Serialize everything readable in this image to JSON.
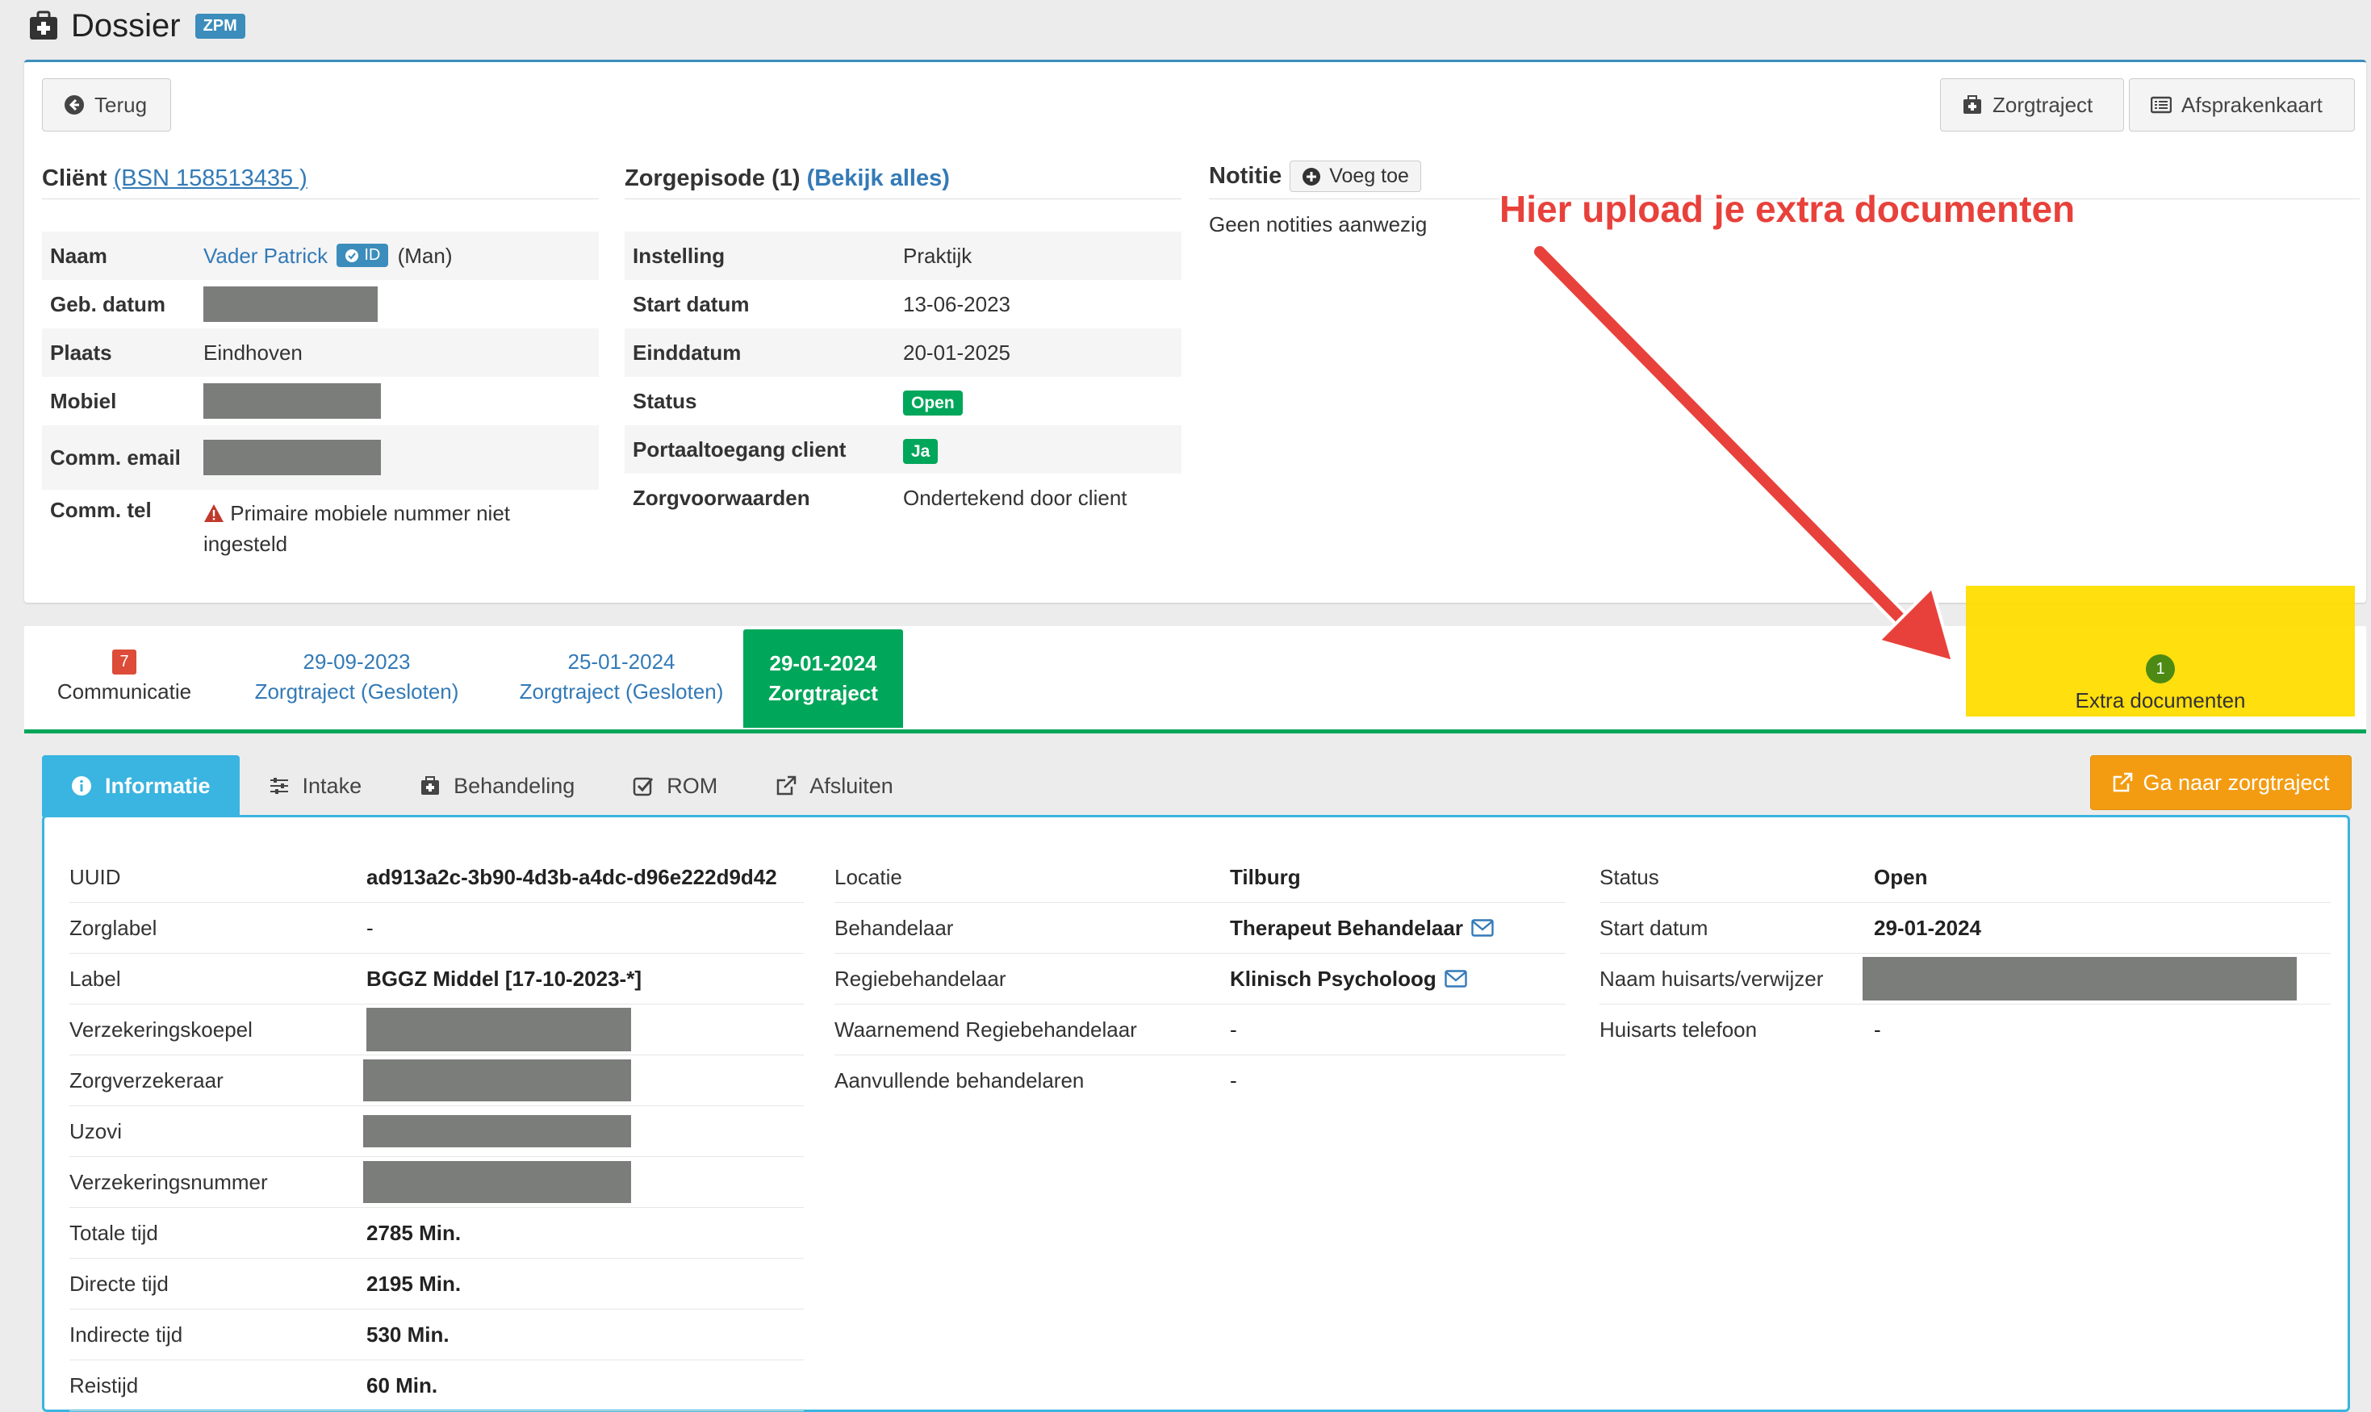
{
  "header": {
    "title": "Dossier",
    "badge": "ZPM",
    "icon": "medkit-icon"
  },
  "toolbar": {
    "back_label": "Terug",
    "zorgtraject_label": "Zorgtraject",
    "afsprakenkaart_label": "Afsprakenkaart"
  },
  "client": {
    "section_label": "Cliënt",
    "bsn_link": "(BSN 158513435 )",
    "rows": {
      "naam_key": "Naam",
      "naam_value": "Vader Patrick",
      "id_badge": "ID",
      "gender": "(Man)",
      "geb_key": "Geb. datum",
      "plaats_key": "Plaats",
      "plaats_value": "Eindhoven",
      "mobiel_key": "Mobiel",
      "email_key": "Comm. email",
      "tel_key": "Comm. tel",
      "tel_value": "Primaire mobiele nummer niet ingesteld"
    }
  },
  "episode": {
    "section_label": "Zorgepisode (1)",
    "view_all": "(Bekijk alles)",
    "rows": [
      {
        "key": "Instelling",
        "value": "Praktijk"
      },
      {
        "key": "Start datum",
        "value": "13-06-2023"
      },
      {
        "key": "Einddatum",
        "value": "20-01-2025"
      },
      {
        "key": "Status",
        "value": "Open"
      },
      {
        "key": "Portaaltoegang client",
        "value": "Ja"
      },
      {
        "key": "Zorgvoorwaarden",
        "value": "Ondertekend door client"
      }
    ]
  },
  "notitie": {
    "section_label": "Notitie",
    "add_label": "Voeg toe",
    "empty": "Geen notities aanwezig"
  },
  "annotation": {
    "text": "Hier upload je extra documenten",
    "color": "#e8413b",
    "highlight": "#ffdd00"
  },
  "tabs": {
    "communicatie": {
      "count": "7",
      "label": "Communicatie"
    },
    "z1": {
      "date": "29-09-2023",
      "label": "Zorgtraject (Gesloten)"
    },
    "z2": {
      "date": "25-01-2024",
      "label": "Zorgtraject (Gesloten)"
    },
    "z3": {
      "date": "29-01-2024",
      "label": "Zorgtraject"
    },
    "extra": {
      "count": "1",
      "label": "Extra documenten"
    }
  },
  "inner_tabs": [
    "Informatie",
    "Intake",
    "Behandeling",
    "ROM",
    "Afsluiten"
  ],
  "goto_button": "Ga naar zorgtraject",
  "info": {
    "col1": [
      {
        "key": "UUID",
        "value": "ad913a2c-3b90-4d3b-a4dc-d96e222d9d42"
      },
      {
        "key": "Zorglabel",
        "value": "-"
      },
      {
        "key": "Label",
        "value": "BGGZ Middel [17-10-2023-*]"
      },
      {
        "key": "Verzekeringskoepel",
        "value": ""
      },
      {
        "key": "Zorgverzekeraar",
        "value": ""
      },
      {
        "key": "Uzovi",
        "value": ""
      },
      {
        "key": "Verzekeringsnummer",
        "value": ""
      },
      {
        "key": "Totale tijd",
        "value": "2785 Min."
      },
      {
        "key": "Directe tijd",
        "value": "2195 Min."
      },
      {
        "key": "Indirecte tijd",
        "value": "530 Min."
      },
      {
        "key": "Reistijd",
        "value": "60 Min."
      }
    ],
    "col2": [
      {
        "key": "Locatie",
        "value": "Tilburg"
      },
      {
        "key": "Behandelaar",
        "value": "Therapeut Behandelaar"
      },
      {
        "key": "Regiebehandelaar",
        "value": "Klinisch Psycholoog"
      },
      {
        "key": "Waarnemend Regiebehandelaar",
        "value": "-"
      },
      {
        "key": "Aanvullende behandelaren",
        "value": "-"
      }
    ],
    "col3": [
      {
        "key": "Status",
        "value": "Open"
      },
      {
        "key": "Start datum",
        "value": "29-01-2024"
      },
      {
        "key": "Naam huisarts/verwijzer",
        "value": ""
      },
      {
        "key": "Huisarts telefoon",
        "value": "-"
      }
    ]
  }
}
